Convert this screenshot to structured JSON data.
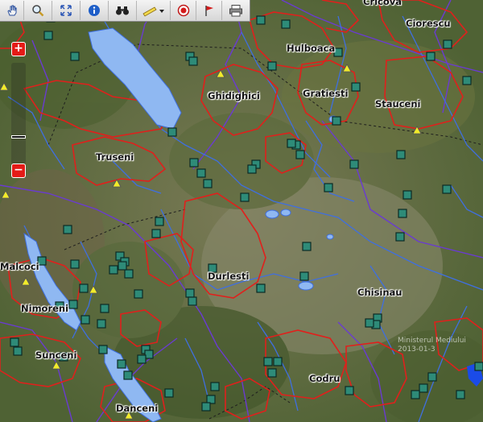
{
  "toolbar": {
    "tools": [
      {
        "name": "pan-tool",
        "icon": "hand-icon"
      },
      {
        "name": "zoom-tool",
        "icon": "magnifier-icon"
      },
      {
        "name": "full-extent-tool",
        "icon": "extent-arrows-icon"
      },
      {
        "name": "info-tool",
        "icon": "info-icon"
      },
      {
        "name": "find-tool",
        "icon": "binoculars-icon"
      },
      {
        "name": "measure-tool",
        "icon": "ruler-icon"
      },
      {
        "name": "record-tool",
        "icon": "target-icon"
      },
      {
        "name": "flag-tool",
        "icon": "flag-icon"
      },
      {
        "name": "print-tool",
        "icon": "printer-icon"
      }
    ]
  },
  "zoom": {
    "plus": "+",
    "minus": "−"
  },
  "places": [
    {
      "name": "Cricova"
    },
    {
      "name": "Ciorescu"
    },
    {
      "name": "Hulboaca"
    },
    {
      "name": "Ghidighici"
    },
    {
      "name": "Gratiesti"
    },
    {
      "name": "Stauceni"
    },
    {
      "name": "Truseni"
    },
    {
      "name": "Durlesti"
    },
    {
      "name": "Chisinau"
    },
    {
      "name": "Malcoci"
    },
    {
      "name": "Nimoreni"
    },
    {
      "name": "Sunceni"
    },
    {
      "name": "Codru"
    },
    {
      "name": "Danceni"
    }
  ],
  "watermark": {
    "line1": "Ministerul Mediului",
    "line2": "2013-01-3"
  },
  "colors": {
    "boundary": "#e0201c",
    "district": "#6a3bd1",
    "river": "#3f6fe0",
    "lake": "#8fb8f2",
    "marker": "#2e8b78",
    "triangle": "#f2ec2a"
  }
}
